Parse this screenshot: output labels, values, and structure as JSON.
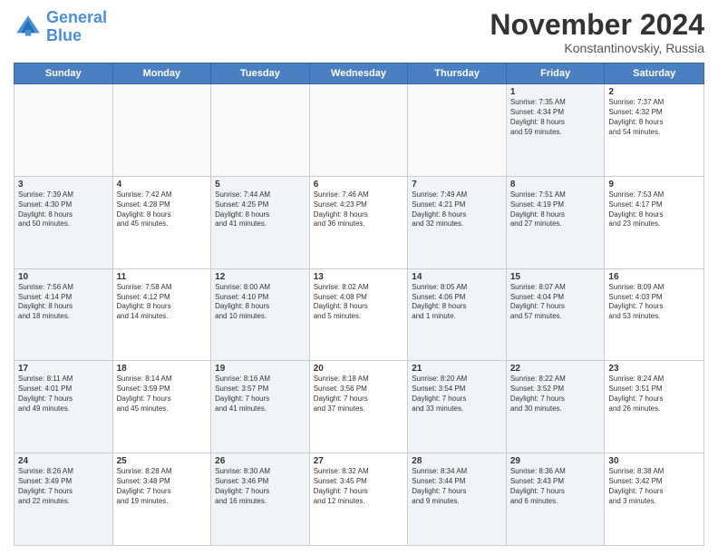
{
  "logo": {
    "line1": "General",
    "line2": "Blue"
  },
  "title": "November 2024",
  "location": "Konstantinovskiy, Russia",
  "header_days": [
    "Sunday",
    "Monday",
    "Tuesday",
    "Wednesday",
    "Thursday",
    "Friday",
    "Saturday"
  ],
  "rows": [
    [
      {
        "day": "",
        "info": "",
        "empty": true
      },
      {
        "day": "",
        "info": "",
        "empty": true
      },
      {
        "day": "",
        "info": "",
        "empty": true
      },
      {
        "day": "",
        "info": "",
        "empty": true
      },
      {
        "day": "",
        "info": "",
        "empty": true
      },
      {
        "day": "1",
        "info": "Sunrise: 7:35 AM\nSunset: 4:34 PM\nDaylight: 8 hours\nand 59 minutes.",
        "shaded": true
      },
      {
        "day": "2",
        "info": "Sunrise: 7:37 AM\nSunset: 4:32 PM\nDaylight: 8 hours\nand 54 minutes.",
        "shaded": false
      }
    ],
    [
      {
        "day": "3",
        "info": "Sunrise: 7:39 AM\nSunset: 4:30 PM\nDaylight: 8 hours\nand 50 minutes.",
        "shaded": true
      },
      {
        "day": "4",
        "info": "Sunrise: 7:42 AM\nSunset: 4:28 PM\nDaylight: 8 hours\nand 45 minutes."
      },
      {
        "day": "5",
        "info": "Sunrise: 7:44 AM\nSunset: 4:25 PM\nDaylight: 8 hours\nand 41 minutes.",
        "shaded": true
      },
      {
        "day": "6",
        "info": "Sunrise: 7:46 AM\nSunset: 4:23 PM\nDaylight: 8 hours\nand 36 minutes."
      },
      {
        "day": "7",
        "info": "Sunrise: 7:49 AM\nSunset: 4:21 PM\nDaylight: 8 hours\nand 32 minutes.",
        "shaded": true
      },
      {
        "day": "8",
        "info": "Sunrise: 7:51 AM\nSunset: 4:19 PM\nDaylight: 8 hours\nand 27 minutes.",
        "shaded": true
      },
      {
        "day": "9",
        "info": "Sunrise: 7:53 AM\nSunset: 4:17 PM\nDaylight: 8 hours\nand 23 minutes."
      }
    ],
    [
      {
        "day": "10",
        "info": "Sunrise: 7:56 AM\nSunset: 4:14 PM\nDaylight: 8 hours\nand 18 minutes.",
        "shaded": true
      },
      {
        "day": "11",
        "info": "Sunrise: 7:58 AM\nSunset: 4:12 PM\nDaylight: 8 hours\nand 14 minutes."
      },
      {
        "day": "12",
        "info": "Sunrise: 8:00 AM\nSunset: 4:10 PM\nDaylight: 8 hours\nand 10 minutes.",
        "shaded": true
      },
      {
        "day": "13",
        "info": "Sunrise: 8:02 AM\nSunset: 4:08 PM\nDaylight: 8 hours\nand 5 minutes."
      },
      {
        "day": "14",
        "info": "Sunrise: 8:05 AM\nSunset: 4:06 PM\nDaylight: 8 hours\nand 1 minute.",
        "shaded": true
      },
      {
        "day": "15",
        "info": "Sunrise: 8:07 AM\nSunset: 4:04 PM\nDaylight: 7 hours\nand 57 minutes.",
        "shaded": true
      },
      {
        "day": "16",
        "info": "Sunrise: 8:09 AM\nSunset: 4:03 PM\nDaylight: 7 hours\nand 53 minutes."
      }
    ],
    [
      {
        "day": "17",
        "info": "Sunrise: 8:11 AM\nSunset: 4:01 PM\nDaylight: 7 hours\nand 49 minutes.",
        "shaded": true
      },
      {
        "day": "18",
        "info": "Sunrise: 8:14 AM\nSunset: 3:59 PM\nDaylight: 7 hours\nand 45 minutes."
      },
      {
        "day": "19",
        "info": "Sunrise: 8:16 AM\nSunset: 3:57 PM\nDaylight: 7 hours\nand 41 minutes.",
        "shaded": true
      },
      {
        "day": "20",
        "info": "Sunrise: 8:18 AM\nSunset: 3:56 PM\nDaylight: 7 hours\nand 37 minutes."
      },
      {
        "day": "21",
        "info": "Sunrise: 8:20 AM\nSunset: 3:54 PM\nDaylight: 7 hours\nand 33 minutes.",
        "shaded": true
      },
      {
        "day": "22",
        "info": "Sunrise: 8:22 AM\nSunset: 3:52 PM\nDaylight: 7 hours\nand 30 minutes.",
        "shaded": true
      },
      {
        "day": "23",
        "info": "Sunrise: 8:24 AM\nSunset: 3:51 PM\nDaylight: 7 hours\nand 26 minutes."
      }
    ],
    [
      {
        "day": "24",
        "info": "Sunrise: 8:26 AM\nSunset: 3:49 PM\nDaylight: 7 hours\nand 22 minutes.",
        "shaded": true
      },
      {
        "day": "25",
        "info": "Sunrise: 8:28 AM\nSunset: 3:48 PM\nDaylight: 7 hours\nand 19 minutes."
      },
      {
        "day": "26",
        "info": "Sunrise: 8:30 AM\nSunset: 3:46 PM\nDaylight: 7 hours\nand 16 minutes.",
        "shaded": true
      },
      {
        "day": "27",
        "info": "Sunrise: 8:32 AM\nSunset: 3:45 PM\nDaylight: 7 hours\nand 12 minutes."
      },
      {
        "day": "28",
        "info": "Sunrise: 8:34 AM\nSunset: 3:44 PM\nDaylight: 7 hours\nand 9 minutes.",
        "shaded": true
      },
      {
        "day": "29",
        "info": "Sunrise: 8:36 AM\nSunset: 3:43 PM\nDaylight: 7 hours\nand 6 minutes.",
        "shaded": true
      },
      {
        "day": "30",
        "info": "Sunrise: 8:38 AM\nSunset: 3:42 PM\nDaylight: 7 hours\nand 3 minutes."
      }
    ]
  ]
}
